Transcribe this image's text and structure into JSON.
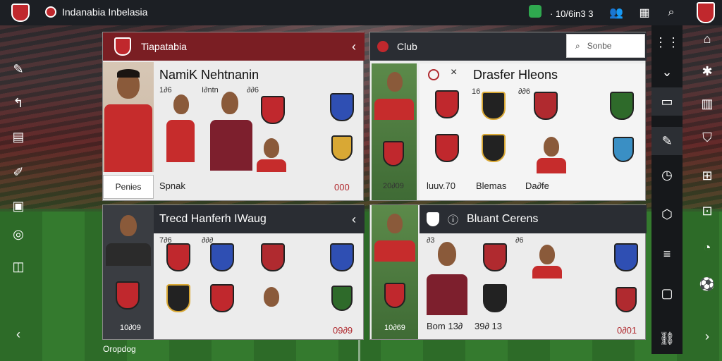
{
  "topbar": {
    "title": "Indanabia Inbelasia",
    "count_text": "· 10/6in3 3",
    "icons": [
      "shield-logo",
      "app-badge-icon",
      "green-status-icon",
      "people-icon",
      "calendar-icon",
      "search-icon",
      "club-crest-icon"
    ]
  },
  "panel_a": {
    "header": "Tiapatabia",
    "title": "NamiK Nehtnanin",
    "labels": [
      "1∂6",
      "I∂ntn",
      "∂∂6"
    ],
    "photo_button": "Penies",
    "footer_text": "Spnak",
    "footer_num": "000"
  },
  "panel_b": {
    "header": "Club",
    "search_placeholder": "Sonbe",
    "title": "Drasfer Hleons",
    "labels": [
      "16",
      "∂∂6"
    ],
    "tile_label": "20∂09",
    "footer_text_1": "luuv.70",
    "footer_text_2": "Blemas",
    "footer_text_3": "Da∂fe"
  },
  "panel_c": {
    "header": "Trecd Hanferh IWaug",
    "labels": [
      "7∂6",
      "∂∂∂"
    ],
    "tile_label": "10∂09",
    "footer_num": "09∂9"
  },
  "panel_d": {
    "header": "Bluant Cerens",
    "labels": [
      "∂3",
      "∂6"
    ],
    "footer_text": "Bom 13∂",
    "footer_text_2": "39∂ 13",
    "footer_num": "0∂01",
    "tile_label": "10∂69"
  },
  "bottom_caption": "Oropdog",
  "colors": {
    "primary_red": "#c0282d",
    "header_red": "#7a1e23",
    "header_dark": "#2a2d33",
    "accent_green": "#2fa84f"
  }
}
